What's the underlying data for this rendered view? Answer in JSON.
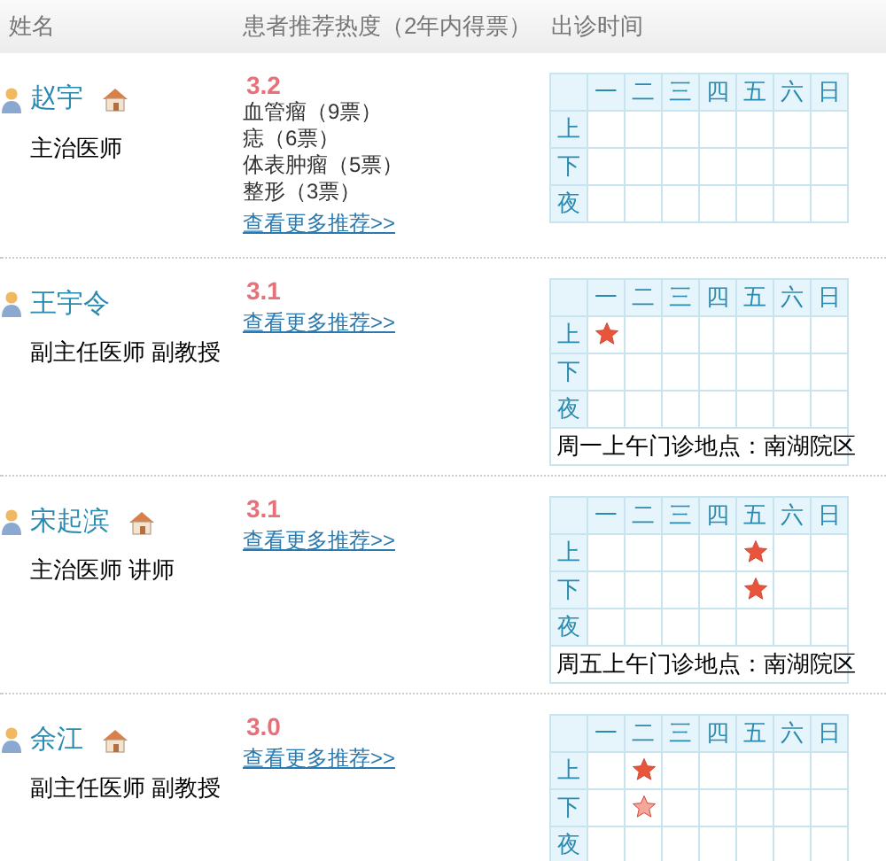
{
  "columns": [
    "姓名",
    "患者推荐热度（2年内得票）",
    "出诊时间"
  ],
  "doctors": [
    {
      "name": "赵宇",
      "home": true,
      "title": "主治医师",
      "score": "3.2",
      "votes": [
        "血管瘤（9票）",
        "痣（6票）",
        "体表肿瘤（5票）",
        "整形（3票）"
      ],
      "more": "查看更多推荐>>",
      "days": [
        "一",
        "二",
        "三",
        "四",
        "五",
        "六",
        "日"
      ],
      "schedule": [
        {
          "label": "上",
          "cells": [
            {
              "star": false
            },
            {
              "star": false
            },
            {
              "star": false
            },
            {
              "star": false
            },
            {
              "star": false
            },
            {
              "star": false
            },
            {
              "star": false
            }
          ]
        },
        {
          "label": "下",
          "cells": [
            {
              "star": false
            },
            {
              "star": false
            },
            {
              "star": false
            },
            {
              "star": false
            },
            {
              "star": false
            },
            {
              "star": false
            },
            {
              "star": false
            }
          ]
        },
        {
          "label": "夜",
          "cells": [
            {
              "star": false
            },
            {
              "star": false
            },
            {
              "star": false
            },
            {
              "star": false
            },
            {
              "star": false
            },
            {
              "star": false
            },
            {
              "star": false
            }
          ]
        }
      ]
    },
    {
      "name": "王宇令",
      "home": false,
      "title": "副主任医师 副教授",
      "score": "3.1",
      "more": "查看更多推荐>>",
      "days": [
        "一",
        "二",
        "三",
        "四",
        "五",
        "六",
        "日"
      ],
      "schedule": [
        {
          "label": "上",
          "cells": [
            {
              "star": true,
              "faded": false
            },
            {
              "star": false
            },
            {
              "star": false
            },
            {
              "star": false
            },
            {
              "star": false
            },
            {
              "star": false
            },
            {
              "star": false
            }
          ]
        },
        {
          "label": "下",
          "cells": [
            {
              "star": false
            },
            {
              "star": false
            },
            {
              "star": false
            },
            {
              "star": false
            },
            {
              "star": false
            },
            {
              "star": false
            },
            {
              "star": false
            }
          ]
        },
        {
          "label": "夜",
          "cells": [
            {
              "star": false
            },
            {
              "star": false
            },
            {
              "star": false
            },
            {
              "star": false
            },
            {
              "star": false
            },
            {
              "star": false
            },
            {
              "star": false
            }
          ]
        }
      ],
      "note": "周一上午门诊地点：南湖院区"
    },
    {
      "name": "宋起滨",
      "home": true,
      "title": "主治医师 讲师",
      "score": "3.1",
      "more": "查看更多推荐>>",
      "days": [
        "一",
        "二",
        "三",
        "四",
        "五",
        "六",
        "日"
      ],
      "schedule": [
        {
          "label": "上",
          "cells": [
            {
              "star": false
            },
            {
              "star": false
            },
            {
              "star": false
            },
            {
              "star": false
            },
            {
              "star": true,
              "faded": false
            },
            {
              "star": false
            },
            {
              "star": false
            }
          ]
        },
        {
          "label": "下",
          "cells": [
            {
              "star": false
            },
            {
              "star": false
            },
            {
              "star": false
            },
            {
              "star": false
            },
            {
              "star": true,
              "faded": false
            },
            {
              "star": false
            },
            {
              "star": false
            }
          ]
        },
        {
          "label": "夜",
          "cells": [
            {
              "star": false
            },
            {
              "star": false
            },
            {
              "star": false
            },
            {
              "star": false
            },
            {
              "star": false
            },
            {
              "star": false
            },
            {
              "star": false
            }
          ]
        }
      ],
      "note": "周五上午门诊地点：南湖院区"
    },
    {
      "name": "余江",
      "home": true,
      "title": "副主任医师 副教授",
      "score": "3.0",
      "more": "查看更多推荐>>",
      "days": [
        "一",
        "二",
        "三",
        "四",
        "五",
        "六",
        "日"
      ],
      "schedule": [
        {
          "label": "上",
          "cells": [
            {
              "star": false
            },
            {
              "star": true,
              "faded": false
            },
            {
              "star": false
            },
            {
              "star": false
            },
            {
              "star": false
            },
            {
              "star": false
            },
            {
              "star": false
            }
          ]
        },
        {
          "label": "下",
          "cells": [
            {
              "star": false
            },
            {
              "star": true,
              "faded": true
            },
            {
              "star": false
            },
            {
              "star": false
            },
            {
              "star": false
            },
            {
              "star": false
            },
            {
              "star": false
            }
          ]
        },
        {
          "label": "夜",
          "cells": [
            {
              "star": false
            },
            {
              "star": false
            },
            {
              "star": false
            },
            {
              "star": false
            },
            {
              "star": false
            },
            {
              "star": false
            },
            {
              "star": false
            }
          ]
        }
      ]
    }
  ]
}
